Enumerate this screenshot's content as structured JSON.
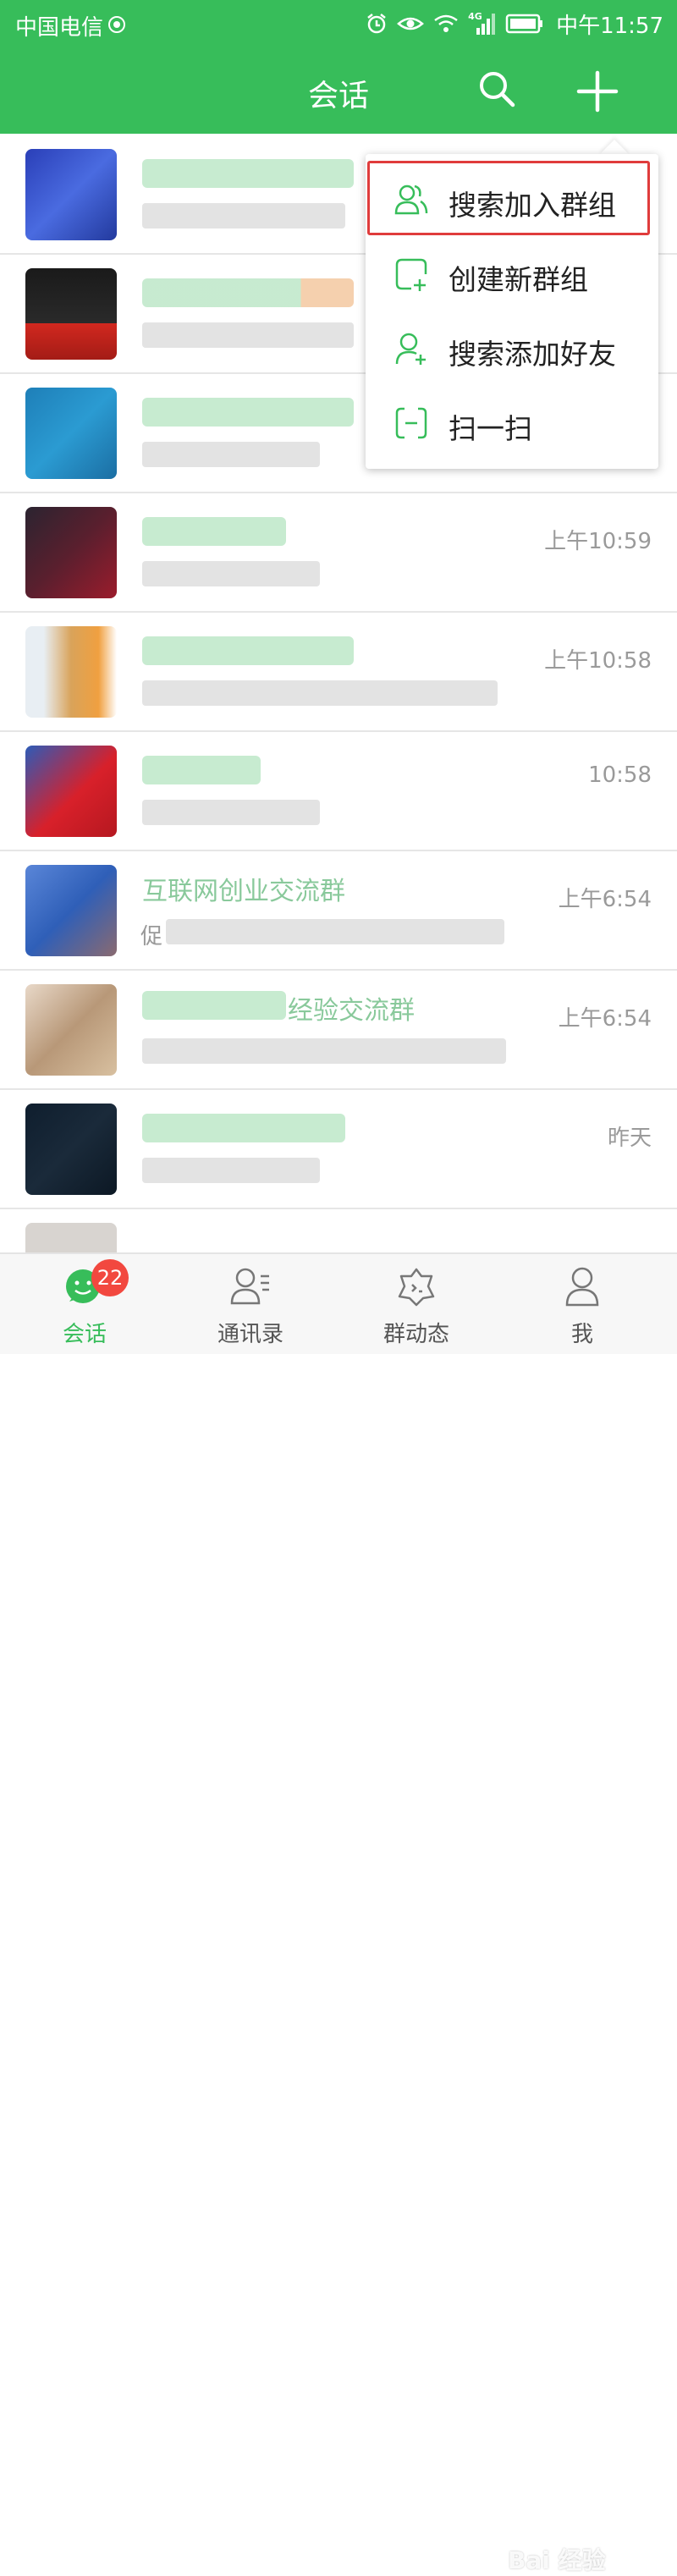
{
  "status_bar": {
    "carrier": "中国电信",
    "network": "4G",
    "time": "中午11:57"
  },
  "header": {
    "title": "会话",
    "search_icon": "search-icon",
    "add_icon": "plus-icon"
  },
  "menu": {
    "items": [
      {
        "label": "搜索加入群组",
        "icon": "group-icon"
      },
      {
        "label": "创建新群组",
        "icon": "create-group-icon"
      },
      {
        "label": "搜索添加好友",
        "icon": "add-friend-icon"
      },
      {
        "label": "扫一扫",
        "icon": "scan-icon"
      }
    ]
  },
  "chats": [
    {
      "time": ""
    },
    {
      "time": ""
    },
    {
      "time": ""
    },
    {
      "time": "上午10:59"
    },
    {
      "time": "上午10:58"
    },
    {
      "time": "10:58"
    },
    {
      "time": "上午6:54",
      "name_partial": "互联网创业交流群",
      "preview_partial": "促"
    },
    {
      "time": "上午6:54",
      "name_partial": "经验交流群"
    },
    {
      "time": "昨天"
    }
  ],
  "tabs": [
    {
      "label": "会话",
      "badge": "22"
    },
    {
      "label": "通讯录"
    },
    {
      "label": "群动态"
    },
    {
      "label": "我"
    }
  ],
  "watermark": "Bai 经验",
  "colors": {
    "brand_green": "#37bd5a",
    "badge_red": "#f2483f",
    "highlight_red": "#e03c3c"
  }
}
